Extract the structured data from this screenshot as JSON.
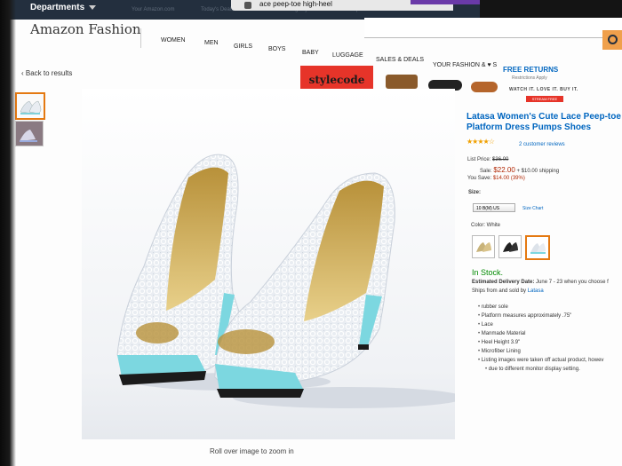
{
  "browser": {
    "tab_title": "ace peep-toe high-heel"
  },
  "topnav": {
    "departments": "Departments",
    "faded_links": [
      "Your Amazon.com",
      "Today's Deals",
      "Gift Cards & Registry",
      "Sell",
      "Help"
    ]
  },
  "header": {
    "brand": "Amazon Fashion",
    "nav": [
      "WOMEN",
      "MEN",
      "GIRLS",
      "BOYS",
      "BABY",
      "LUGGAGE",
      "SALES & DEALS",
      "YOUR FASHION & ♥ S"
    ],
    "free_returns": "FREE RETURNS",
    "free_returns_sub": "Restrictions Apply",
    "back": "‹ Back to results"
  },
  "banner": {
    "brand": "stylecode",
    "tagline": "WATCH IT. LOVE IT. BUY IT.",
    "button": "STREAM FREE"
  },
  "gallery": {
    "caption": "Roll over image to zoom in"
  },
  "product": {
    "title_line1": "Latasa Women's Cute Lace Peep-toe H",
    "title_line2": "Platform Dress Pumps Shoes",
    "stars": "★★★★☆",
    "reviews": "2 customer reviews",
    "list_price_label": "List Price:",
    "list_price": "$36.00",
    "sale_label": "Sale:",
    "sale_price": "$22.00",
    "shipping": "+ $10.00 shipping",
    "you_save_label": "You Save:",
    "you_save": "$14.00 (39%)",
    "size_label": "Size:",
    "size_value": "10 B(M) US",
    "size_chart": "Size Chart",
    "color_label": "Color: White",
    "stock": "In Stock.",
    "delivery_label": "Estimated Delivery Date:",
    "delivery_text": "June 7 - 23 when you choose f",
    "ships_prefix": "Ships from and sold by",
    "seller": "Latasa",
    "features": [
      "rubber sole",
      "Platform measures approximately .75\"",
      "Lace",
      "Manmade Material",
      "Heel Height 3.9\"",
      "Microfiber Lining",
      "Listing images were taken off actual product, howev",
      "due to different monitor display setting."
    ]
  },
  "colors": {
    "link": "#0066c0",
    "price": "#b12704",
    "stock": "#008a00",
    "nav_bg": "#232f3e",
    "accent": "#e47911"
  }
}
